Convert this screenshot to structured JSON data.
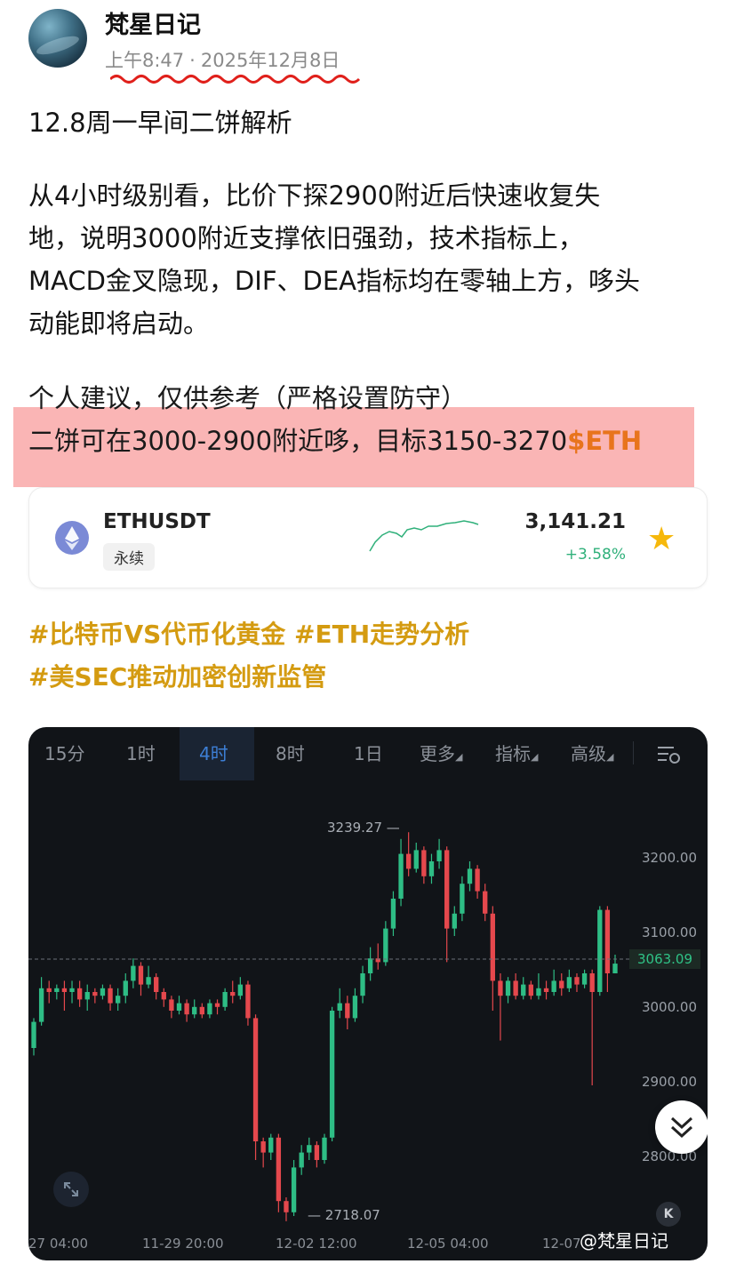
{
  "post": {
    "author": "梵星日记",
    "time": "上午8:47",
    "date": "2025年12月8日",
    "title": "12.8周一早间二饼解析",
    "body_lines": [
      "从4小时级别看，比价下探2900附近后快速收复失",
      "地，说明3000附近支撑依旧强劲，技术指标上，",
      "MACD金叉隐现，DIF、DEA指标均在零轴上方，哆头",
      "动能即将启动。"
    ],
    "advice_line": "个人建议，仅供参考（严格设置防守）",
    "target_text": "二饼可在3000-2900附近哆，目标3150-3270",
    "target_ticker": "$ETH"
  },
  "ticker_card": {
    "symbol": "ETHUSDT",
    "tag": "永续",
    "price": "3,141.21",
    "change": "+3.58%",
    "star_icon": "star-icon",
    "colors": {
      "up": "#2fb07a",
      "star": "#f6b80b"
    }
  },
  "hashtags": [
    "#比特币VS代币化黄金 #ETH走势分析",
    "#美SEC推动加密创新监管"
  ],
  "chart_toolbar": {
    "tabs": [
      "15分",
      "1时",
      "4时",
      "8时",
      "1日"
    ],
    "active_tab": "4时",
    "more": "更多",
    "indicators": "指标",
    "advanced": "高级"
  },
  "chart_data": {
    "type": "candlestick",
    "y_ticks": [
      "3200.00",
      "3100.00",
      "3000.00",
      "2900.00",
      "2800.00"
    ],
    "x_ticks": [
      "27 04:00",
      "11-29 20:00",
      "12-02 12:00",
      "12-05 04:00",
      "12-07"
    ],
    "current_price": "3063.09",
    "high_label": "3239.27",
    "low_label": "2718.07",
    "ylim": [
      2700,
      3260
    ],
    "colors": {
      "up": "#2ebd85",
      "down": "#e5484d"
    },
    "candles": [
      [
        2950,
        2985,
        2940,
        2990
      ],
      [
        2985,
        3030,
        2980,
        3045
      ],
      [
        3030,
        3025,
        3010,
        3040
      ],
      [
        3025,
        3030,
        3015,
        3035
      ],
      [
        3030,
        3025,
        3000,
        3040
      ],
      [
        3025,
        3030,
        3010,
        3040
      ],
      [
        3030,
        3015,
        3005,
        3040
      ],
      [
        3015,
        3025,
        3000,
        3035
      ],
      [
        3025,
        3020,
        3010,
        3030
      ],
      [
        3020,
        3030,
        3015,
        3035
      ],
      [
        3030,
        3010,
        3000,
        3035
      ],
      [
        3010,
        3020,
        3000,
        3030
      ],
      [
        3020,
        3040,
        3010,
        3050
      ],
      [
        3040,
        3060,
        3030,
        3070
      ],
      [
        3060,
        3035,
        3020,
        3065
      ],
      [
        3035,
        3045,
        3030,
        3060
      ],
      [
        3045,
        3025,
        3015,
        3050
      ],
      [
        3025,
        3015,
        3005,
        3030
      ],
      [
        3015,
        3000,
        2990,
        3020
      ],
      [
        3000,
        3010,
        2995,
        3020
      ],
      [
        3010,
        2995,
        2985,
        3015
      ],
      [
        2995,
        3005,
        2990,
        3015
      ],
      [
        3005,
        2995,
        2990,
        3010
      ],
      [
        2995,
        3010,
        2990,
        3015
      ],
      [
        3010,
        3005,
        2995,
        3015
      ],
      [
        3005,
        3025,
        3000,
        3030
      ],
      [
        3025,
        3020,
        3010,
        3040
      ],
      [
        3020,
        3035,
        3015,
        3045
      ],
      [
        3035,
        2990,
        2980,
        3040
      ],
      [
        2990,
        2825,
        2800,
        2995
      ],
      [
        2825,
        2810,
        2790,
        2830
      ],
      [
        2810,
        2830,
        2800,
        2835
      ],
      [
        2830,
        2745,
        2730,
        2835
      ],
      [
        2745,
        2730,
        2718,
        2750
      ],
      [
        2730,
        2790,
        2725,
        2800
      ],
      [
        2790,
        2810,
        2780,
        2820
      ],
      [
        2810,
        2820,
        2800,
        2830
      ],
      [
        2820,
        2800,
        2790,
        2825
      ],
      [
        2800,
        2830,
        2795,
        2835
      ],
      [
        2830,
        3000,
        2825,
        3005
      ],
      [
        3000,
        3010,
        2990,
        3030
      ],
      [
        3010,
        2990,
        2975,
        3020
      ],
      [
        2990,
        3020,
        2985,
        3030
      ],
      [
        3020,
        3050,
        3010,
        3060
      ],
      [
        3050,
        3070,
        3040,
        3085
      ],
      [
        3070,
        3065,
        3055,
        3090
      ],
      [
        3065,
        3110,
        3060,
        3120
      ],
      [
        3110,
        3150,
        3100,
        3160
      ],
      [
        3150,
        3210,
        3140,
        3230
      ],
      [
        3210,
        3190,
        3180,
        3239
      ],
      [
        3190,
        3215,
        3185,
        3225
      ],
      [
        3215,
        3180,
        3170,
        3220
      ],
      [
        3180,
        3200,
        3170,
        3210
      ],
      [
        3200,
        3215,
        3190,
        3230
      ],
      [
        3215,
        3110,
        3065,
        3220
      ],
      [
        3110,
        3130,
        3100,
        3140
      ],
      [
        3130,
        3170,
        3120,
        3180
      ],
      [
        3170,
        3190,
        3160,
        3200
      ],
      [
        3190,
        3160,
        3150,
        3195
      ],
      [
        3160,
        3130,
        3120,
        3170
      ],
      [
        3130,
        3040,
        3000,
        3140
      ],
      [
        3040,
        3020,
        2960,
        3050
      ],
      [
        3020,
        3040,
        3010,
        3045
      ],
      [
        3040,
        3020,
        3015,
        3050
      ],
      [
        3020,
        3035,
        3015,
        3045
      ],
      [
        3035,
        3020,
        3015,
        3040
      ],
      [
        3020,
        3030,
        3015,
        3050
      ],
      [
        3030,
        3025,
        3015,
        3040
      ],
      [
        3025,
        3040,
        3020,
        3055
      ],
      [
        3040,
        3030,
        3020,
        3050
      ],
      [
        3030,
        3045,
        3025,
        3055
      ],
      [
        3045,
        3035,
        3025,
        3050
      ],
      [
        3035,
        3050,
        3030,
        3055
      ],
      [
        3050,
        3025,
        2900,
        3055
      ],
      [
        3025,
        3135,
        3020,
        3140
      ],
      [
        3135,
        3050,
        3025,
        3140
      ],
      [
        3050,
        3063,
        3050,
        3075
      ]
    ]
  },
  "watermark": "@梵星日记",
  "k_button": "K"
}
